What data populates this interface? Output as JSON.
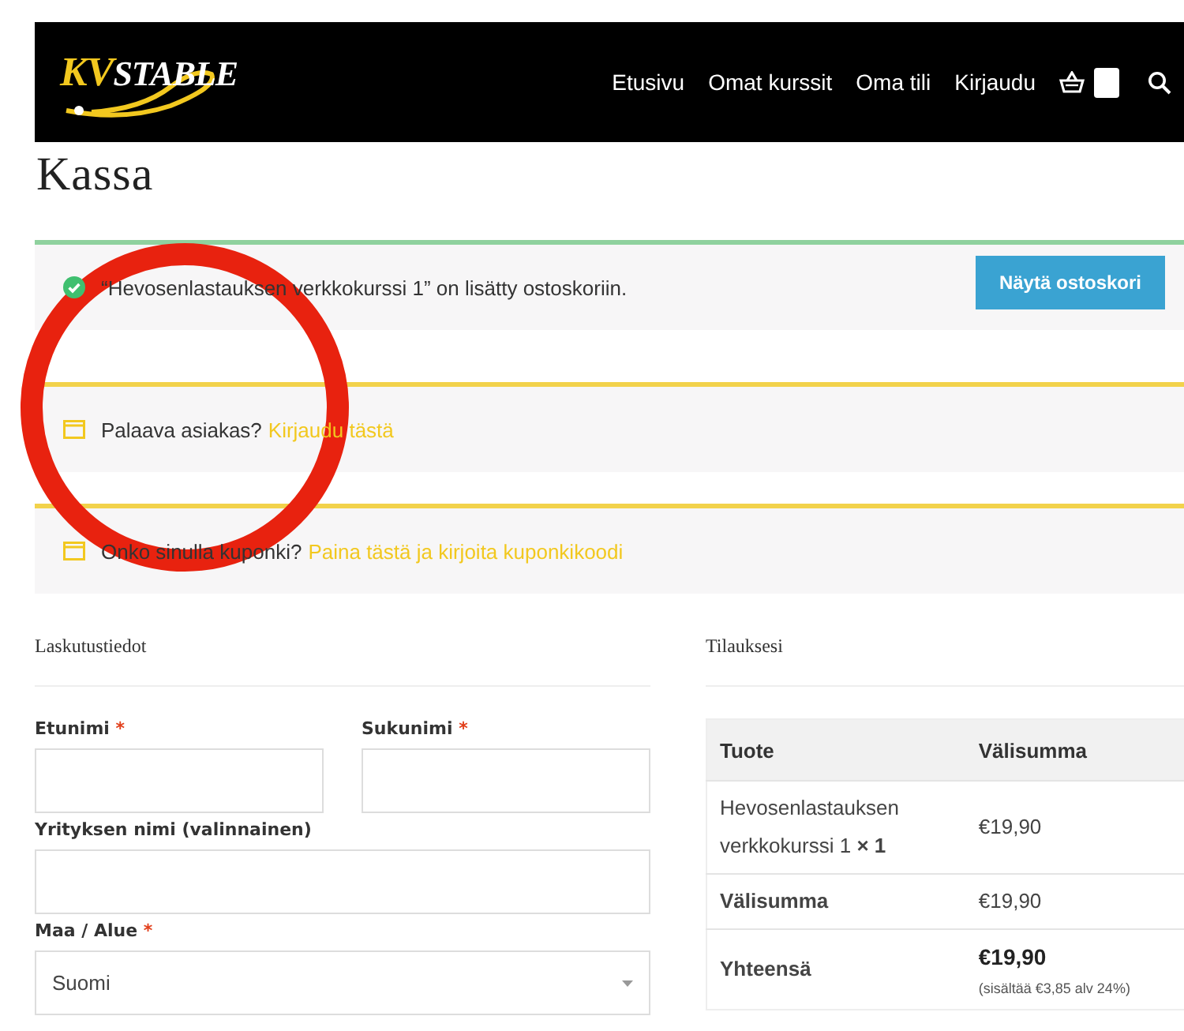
{
  "header": {
    "logo": {
      "parts": [
        "KV",
        "STABLE"
      ]
    },
    "nav": [
      "Etusivu",
      "Omat kurssit",
      "Oma tili",
      "Kirjaudu"
    ]
  },
  "title": "Kassa",
  "notices": [
    {
      "kind": "success",
      "text": "“Hevosenlastauksen verkkokurssi 1” on lisätty ostoskoriin.",
      "button": "Näytä ostoskori"
    },
    {
      "kind": "info",
      "text": "Palaava asiakas?",
      "link": "Kirjaudu tästä"
    },
    {
      "kind": "info",
      "text": "Onko sinulla kuponki?",
      "link": "Paina tästä ja kirjoita kuponkikoodi"
    }
  ],
  "billing": {
    "heading": "Laskutustiedot",
    "fields": [
      {
        "kind": "input",
        "label": "Etunimi",
        "required_mark": "*",
        "half": true
      },
      {
        "kind": "input",
        "label": "Sukunimi",
        "required_mark": "*",
        "half": true
      },
      {
        "kind": "input",
        "label": "Yrityksen nimi (valinnainen)",
        "half": false
      },
      {
        "kind": "select",
        "label": "Maa / Alue",
        "required_mark": "*",
        "value": "Suomi",
        "half": false
      }
    ]
  },
  "order": {
    "heading": "Tilauksesi",
    "columns": [
      "Tuote",
      "Välisumma"
    ],
    "rows": [
      {
        "kind": "item",
        "cells": [
          "Hevosenlastauksen verkkokurssi 1 **× 1**",
          "€19,90"
        ]
      },
      {
        "kind": "subtotal",
        "cells": [
          "Välisumma",
          "€19,90"
        ]
      },
      {
        "kind": "total",
        "cells": [
          "Yhteensä",
          "€19,90"
        ],
        "note": "(sisältää €3,85 alv 24%)"
      }
    ]
  },
  "annotation": {
    "kind": "circle"
  }
}
